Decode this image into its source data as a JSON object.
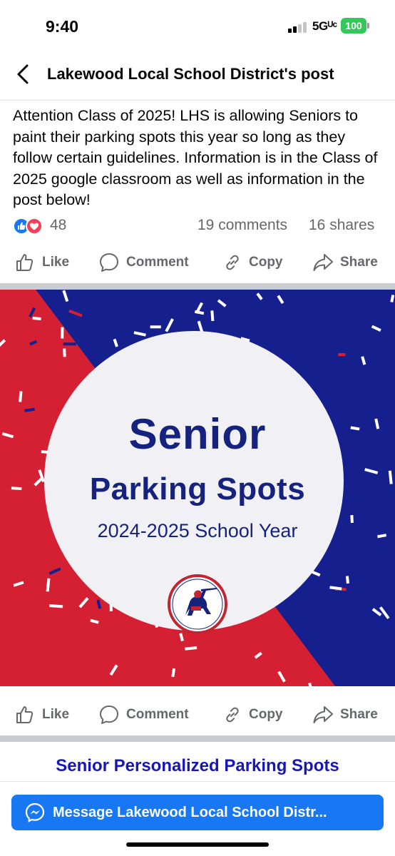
{
  "status_bar": {
    "time": "9:40",
    "network": "5Gᵁᶜ",
    "battery": "100"
  },
  "header": {
    "back_icon": "chevron-left-icon",
    "title": "Lakewood Local School District's post"
  },
  "post": {
    "text": "Attention Class of 2025! LHS is allowing Seniors to paint their parking spots this year so long as they follow certain guidelines. Information is in the Class of 2025 google classroom as well as information in the post below!",
    "reaction_icons": [
      "like-icon",
      "love-icon"
    ],
    "reaction_count": "48",
    "comments": "19 comments",
    "shares": "16 shares"
  },
  "actions": {
    "like": "Like",
    "comment": "Comment",
    "copy": "Copy",
    "share": "Share"
  },
  "image": {
    "line1": "Senior",
    "line2": "Parking Spots",
    "line3": "2024-2025 School Year",
    "mascot_icon": "knight-mascot-icon",
    "colors": {
      "red": "#d52034",
      "navy": "#15208e",
      "circle": "#f0f0f5",
      "text": "#16237e"
    }
  },
  "link": {
    "title": "Senior Personalized Parking Spots"
  },
  "message_button": {
    "label": "Message Lakewood Local School Distr..."
  },
  "colors": {
    "facebook_blue": "#1877f2",
    "secondary_text": "#65676b",
    "love_red": "#f33e58"
  }
}
